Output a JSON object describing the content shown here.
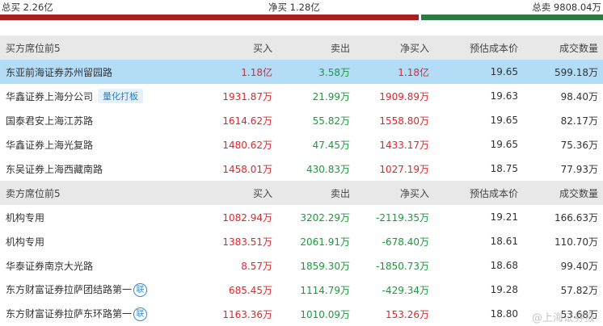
{
  "summary": {
    "total_buy": "总买 2.26亿",
    "net_buy": "净买 1.28亿",
    "total_sell": "总卖 9808.04万",
    "buy_ratio": 0.697
  },
  "columns": {
    "buy": "买入",
    "sell": "卖出",
    "net": "净买入",
    "cost": "预估成本价",
    "volume": "成交数量"
  },
  "buy_section": {
    "title": "买方席位前5",
    "rows": [
      {
        "name": "东亚前海证券苏州留园路",
        "tag": "",
        "buy": "1.18亿",
        "sell": "3.58万",
        "net": "1.18亿",
        "cost": "19.65",
        "volume": "599.18万"
      },
      {
        "name": "华鑫证券上海分公司",
        "tag": "量化打板",
        "buy": "1931.87万",
        "sell": "21.99万",
        "net": "1909.89万",
        "cost": "19.63",
        "volume": "98.40万"
      },
      {
        "name": "国泰君安上海江苏路",
        "tag": "",
        "buy": "1614.62万",
        "sell": "55.82万",
        "net": "1558.80万",
        "cost": "19.65",
        "volume": "82.17万"
      },
      {
        "name": "华鑫证券上海光复路",
        "tag": "",
        "buy": "1480.62万",
        "sell": "47.45万",
        "net": "1433.17万",
        "cost": "19.65",
        "volume": "75.36万"
      },
      {
        "name": "东吴证券上海西藏南路",
        "tag": "",
        "buy": "1458.01万",
        "sell": "430.83万",
        "net": "1027.19万",
        "cost": "18.75",
        "volume": "77.93万"
      }
    ]
  },
  "sell_section": {
    "title": "卖方席位前5",
    "rows": [
      {
        "name": "机构专用",
        "buy": "1082.94万",
        "sell": "3202.29万",
        "net": "-2119.35万",
        "cost": "19.21",
        "volume": "166.63万"
      },
      {
        "name": "机构专用",
        "buy": "1383.51万",
        "sell": "2061.91万",
        "net": "-678.40万",
        "cost": "18.61",
        "volume": "110.70万"
      },
      {
        "name": "华泰证券南京大光路",
        "buy": "8.57万",
        "sell": "1859.30万",
        "net": "-1850.73万",
        "cost": "18.68",
        "volume": "99.40万"
      },
      {
        "name": "东方财富证券拉萨团结路第一",
        "badge": "联",
        "buy": "685.45万",
        "sell": "1114.79万",
        "net": "-429.34万",
        "cost": "19.28",
        "volume": "57.82万"
      },
      {
        "name": "东方财富证券拉萨东环路第一",
        "badge": "联",
        "buy": "1163.36万",
        "sell": "1010.09万",
        "net": "153.26万",
        "cost": "18.80",
        "volume": "53.68万"
      }
    ]
  },
  "watermark": "@上海证券报"
}
